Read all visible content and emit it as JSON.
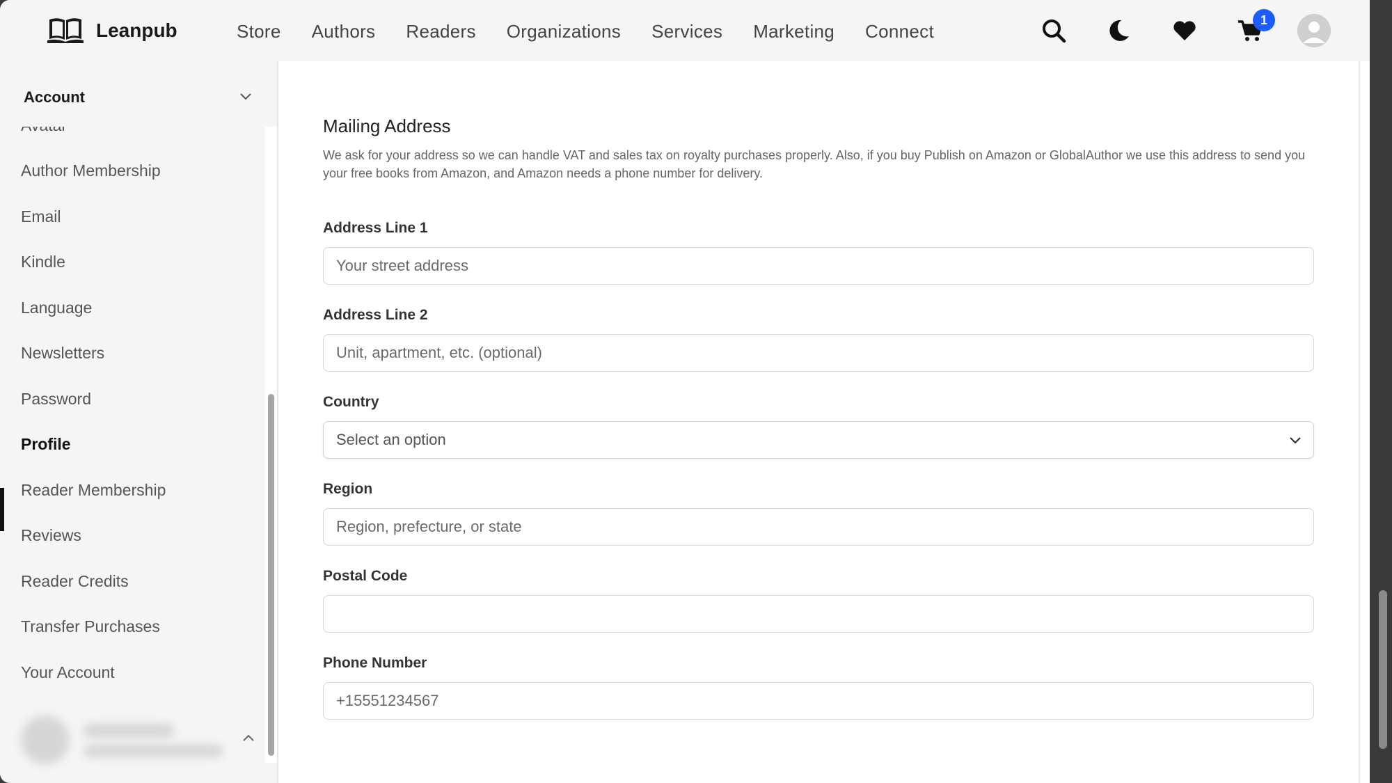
{
  "header": {
    "brand": "Leanpub",
    "nav": [
      "Store",
      "Authors",
      "Readers",
      "Organizations",
      "Services",
      "Marketing",
      "Connect"
    ],
    "cart_count": "1",
    "icons": [
      "search-icon",
      "moon-icon",
      "heart-icon",
      "cart-icon",
      "avatar"
    ]
  },
  "sidebar": {
    "title": "Account",
    "partial_item": "Avatar",
    "items": [
      {
        "label": "Author Membership"
      },
      {
        "label": "Email"
      },
      {
        "label": "Kindle"
      },
      {
        "label": "Language"
      },
      {
        "label": "Newsletters"
      },
      {
        "label": "Password"
      },
      {
        "label": "Profile",
        "active": true
      },
      {
        "label": "Reader Membership"
      },
      {
        "label": "Reviews"
      },
      {
        "label": "Reader Credits"
      },
      {
        "label": "Transfer Purchases"
      },
      {
        "label": "Your Account"
      }
    ]
  },
  "main": {
    "section_title": "Mailing Address",
    "description": "We ask for your address so we can handle VAT and sales tax on royalty purchases properly. Also, if you buy Publish on Amazon or GlobalAuthor we use this address to send you your free books from Amazon, and Amazon needs a phone number for delivery.",
    "fields": {
      "address1": {
        "label": "Address Line 1",
        "placeholder": "Your street address",
        "value": ""
      },
      "address2": {
        "label": "Address Line 2",
        "placeholder": "Unit, apartment, etc. (optional)",
        "value": ""
      },
      "country": {
        "label": "Country",
        "selected": "Select an option"
      },
      "region": {
        "label": "Region",
        "placeholder": "Region, prefecture, or state",
        "value": ""
      },
      "postal": {
        "label": "Postal Code",
        "placeholder": "",
        "value": ""
      },
      "phone": {
        "label": "Phone Number",
        "placeholder": "+15551234567",
        "value": ""
      }
    }
  },
  "colors": {
    "accent": "#1a5cff",
    "sidebar_bg": "#f5f5f5",
    "active_bar": "#111111"
  }
}
